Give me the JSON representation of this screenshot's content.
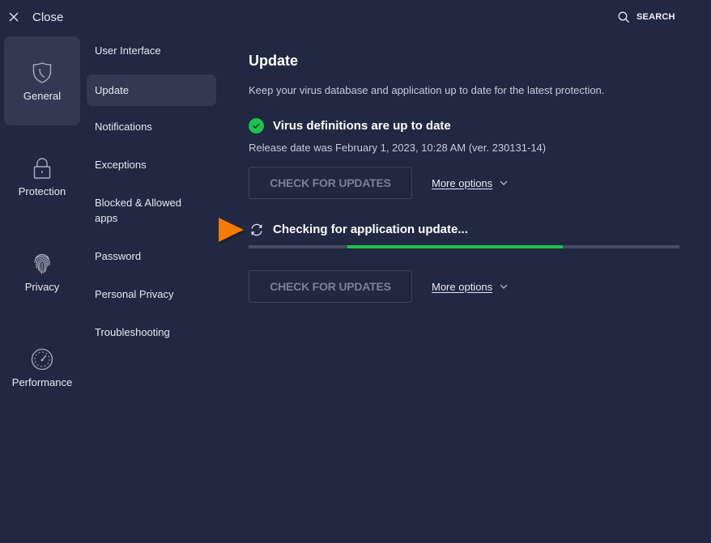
{
  "header": {
    "close_label": "Close",
    "close_icon": "x-icon",
    "search_label": "SEARCH",
    "search_icon": "magnifier-icon"
  },
  "categories": [
    {
      "label": "General",
      "icon": "shield-icon",
      "active": true
    },
    {
      "label": "Protection",
      "icon": "lock-icon",
      "active": false
    },
    {
      "label": "Privacy",
      "icon": "fingerprint-icon",
      "active": false
    },
    {
      "label": "Performance",
      "icon": "speedometer-icon",
      "active": false
    }
  ],
  "subnav": [
    {
      "label": "User Interface",
      "active": false
    },
    {
      "label": "Update",
      "active": true
    },
    {
      "label": "Notifications",
      "active": false
    },
    {
      "label": "Exceptions",
      "active": false
    },
    {
      "label": "Blocked & Allowed apps",
      "active": false
    },
    {
      "label": "Password",
      "active": false
    },
    {
      "label": "Personal Privacy",
      "active": false
    },
    {
      "label": "Troubleshooting",
      "active": false
    }
  ],
  "main": {
    "title": "Update",
    "description": "Keep your virus database and application up to date for the latest protection.",
    "virus_definitions": {
      "status": "Virus definitions are up to date",
      "status_icon": "check-circle-icon",
      "release_info": "Release date was February 1, 2023, 10:28 AM (ver. 230131-14)",
      "check_button": "CHECK FOR UPDATES",
      "more_options": "More options"
    },
    "application": {
      "status": "Checking for application update...",
      "status_icon": "refresh-icon",
      "progress_state": "indeterminate",
      "progress_segment_start": 0.23,
      "progress_segment_end": 0.73,
      "check_button": "CHECK FOR UPDATES",
      "more_options": "More options"
    }
  },
  "colors": {
    "background": "#212842",
    "active_item": "#313a52",
    "success": "#1fc14d",
    "annotation_arrow": "#f57c00",
    "track": "#454c62",
    "disabled_text": "#7a8196"
  }
}
